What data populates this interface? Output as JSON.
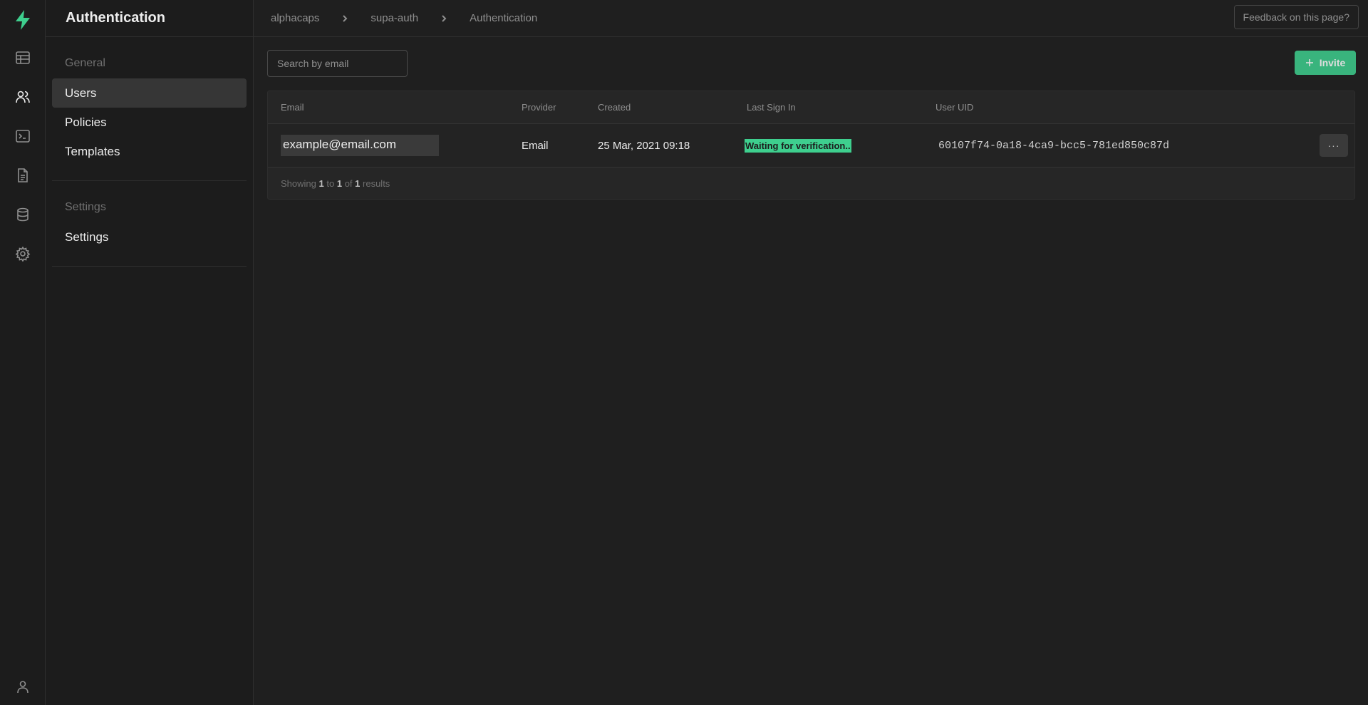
{
  "section": {
    "title": "Authentication"
  },
  "sidebar": {
    "groups": [
      {
        "title": "General",
        "items": [
          {
            "label": "Users",
            "active": true
          },
          {
            "label": "Policies"
          },
          {
            "label": "Templates"
          }
        ]
      },
      {
        "title": "Settings",
        "items": [
          {
            "label": "Settings"
          }
        ]
      }
    ]
  },
  "breadcrumb": [
    "alphacaps",
    "supa-auth",
    "Authentication"
  ],
  "header": {
    "feedback_label": "Feedback on this page?"
  },
  "search": {
    "placeholder": "Search by email",
    "value": ""
  },
  "actions": {
    "invite_label": "Invite",
    "row_menu_label": "···"
  },
  "table": {
    "columns": [
      "Email",
      "Provider",
      "Created",
      "Last Sign In",
      "User UID"
    ],
    "rows": [
      {
        "email": "example@email.com",
        "provider": "Email",
        "created": "25 Mar, 2021 09:18",
        "last_sign_in": "Waiting for verification..",
        "uid": "60107f74-0a18-4ca9-bcc5-781ed850c87d"
      }
    ],
    "footer": {
      "prefix": "Showing",
      "from": "1",
      "to_word": "to",
      "to": "1",
      "of_word": "of",
      "total": "1",
      "suffix": "results"
    }
  },
  "colors": {
    "brand": "#3ecf8e",
    "background": "#1f1f1f",
    "panel": "#1c1c1c"
  },
  "icons": {
    "logo": "supabase-bolt-icon",
    "rail": [
      "table-editor-icon",
      "users-icon",
      "terminal-icon",
      "document-icon",
      "database-icon",
      "gear-icon"
    ],
    "bottom": "user-profile-icon"
  }
}
